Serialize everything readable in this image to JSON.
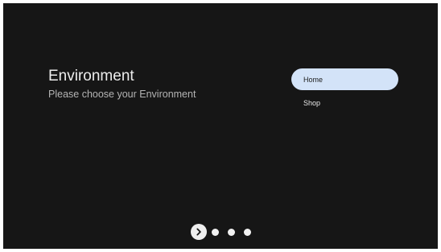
{
  "setup": {
    "title": "Environment",
    "subtitle": "Please choose your Environment"
  },
  "options": {
    "items": [
      {
        "label": "Home",
        "selected": true
      },
      {
        "label": "Shop",
        "selected": false
      }
    ]
  },
  "pager": {
    "next_icon": "chevron-right-icon",
    "current_step": 1,
    "total_steps": 4
  },
  "colors": {
    "background": "#161616",
    "selected_option": "#d3e3f8",
    "text_primary": "#ececec",
    "text_secondary": "#b4b4b4"
  }
}
